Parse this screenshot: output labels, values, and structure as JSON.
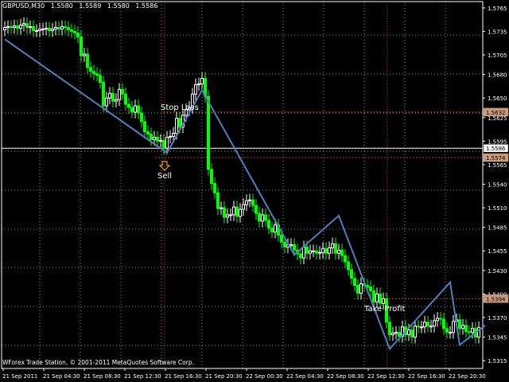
{
  "header": {
    "symbol_timeframe": "GBPUSD,M30",
    "open": "1.5580",
    "high": "1.5589",
    "low": "1.5580",
    "close": "1.5586"
  },
  "copyright": "WForex Trade Station, © 2001-2011 MetaQuotes Software Corp.",
  "annotations": {
    "stop_loss_label": "Stop Loss",
    "sell_label": "Sell",
    "take_profit_label": "Take Profit"
  },
  "colors": {
    "background": "#000000",
    "grid": "#ffffff",
    "bull_candle": "#ffffff",
    "bear_candle": "#00ff00",
    "zigzag": "#4f7fbf",
    "level_line": "#bf3a3a",
    "current_price_line": "#ffffff",
    "sell_arrow": "#e8a000"
  },
  "chart_data": {
    "type": "candlestick",
    "symbol": "GBPUSD",
    "timeframe": "M30",
    "ylim": [
      1.5305,
      1.5773
    ],
    "y_ticks": [
      "1.5765",
      "1.5735",
      "1.5705",
      "1.5680",
      "1.5650",
      "1.5625",
      "1.5595",
      "1.5565",
      "1.5540",
      "1.5510",
      "1.5485",
      "1.5455",
      "1.5430",
      "1.5400",
      "1.5370",
      "1.5345",
      "1.5315"
    ],
    "x_ticks": [
      "21 Sep 2011",
      "21 Sep 04:30",
      "21 Sep 08:30",
      "21 Sep 12:30",
      "21 Sep 16:30",
      "21 Sep 20:30",
      "22 Sep 00:30",
      "22 Sep 04:30",
      "22 Sep 08:30",
      "22 Sep 12:30",
      "22 Sep 16:30",
      "22 Sep 20:30"
    ],
    "price_tags": [
      {
        "value": "1.5632",
        "role": "stop-loss"
      },
      {
        "value": "1.5586",
        "role": "current"
      },
      {
        "value": "1.5574",
        "role": "entry"
      },
      {
        "value": "1.5394",
        "role": "take-profit"
      }
    ],
    "levels": {
      "stop_loss": 1.5632,
      "entry": 1.5574,
      "current": 1.5586,
      "take_profit": 1.5394
    },
    "zigzag": [
      [
        0,
        1.5725
      ],
      [
        51,
        1.558
      ],
      [
        62,
        1.566
      ],
      [
        91,
        1.545
      ],
      [
        105,
        1.55
      ],
      [
        121,
        1.533
      ],
      [
        140,
        1.5415
      ],
      [
        143,
        1.5335
      ],
      [
        151,
        1.536
      ]
    ],
    "closes": [
      1.574,
      1.5741,
      1.574,
      1.5742,
      1.5739,
      1.5743,
      1.5745,
      1.574,
      1.5741,
      1.5736,
      1.5736,
      1.5738,
      1.5738,
      1.5739,
      1.5736,
      1.5738,
      1.574,
      1.5738,
      1.5741,
      1.574,
      1.5737,
      1.5735,
      1.5733,
      1.5728,
      1.5704,
      1.5706,
      1.5689,
      1.5684,
      1.5681,
      1.5679,
      1.567,
      1.564,
      1.565,
      1.5656,
      1.5646,
      1.5648,
      1.5661,
      1.5655,
      1.5642,
      1.5638,
      1.5632,
      1.564,
      1.5631,
      1.562,
      1.5607,
      1.5604,
      1.5597,
      1.56,
      1.5595,
      1.5596,
      1.5586,
      1.56,
      1.5601,
      1.5605,
      1.5624,
      1.5613,
      1.5628,
      1.5635,
      1.5638,
      1.5655,
      1.5667,
      1.5668,
      1.5675,
      1.5652,
      1.5559,
      1.5541,
      1.5529,
      1.5509,
      1.551,
      1.5498,
      1.5501,
      1.5501,
      1.5511,
      1.5499,
      1.5508,
      1.5514,
      1.5519,
      1.552,
      1.5513,
      1.5503,
      1.5493,
      1.5501,
      1.5494,
      1.5484,
      1.5479,
      1.5488,
      1.5475,
      1.5466,
      1.546,
      1.5463,
      1.5463,
      1.5456,
      1.5451,
      1.5446,
      1.546,
      1.5452,
      1.5455,
      1.5455,
      1.5452,
      1.5453,
      1.5458,
      1.5452,
      1.5459,
      1.5464,
      1.5452,
      1.5456,
      1.5449,
      1.5441,
      1.5431,
      1.542,
      1.5411,
      1.5401,
      1.5413,
      1.5411,
      1.5409,
      1.5404,
      1.539,
      1.54,
      1.5388,
      1.5394,
      1.5364,
      1.5348,
      1.535,
      1.5351,
      1.5346,
      1.5358,
      1.5348,
      1.5354,
      1.5345,
      1.5359,
      1.5358,
      1.5358,
      1.5364,
      1.5359,
      1.5359,
      1.5366,
      1.5369,
      1.5368,
      1.5356,
      1.5351,
      1.5351,
      1.5365,
      1.5367,
      1.5356,
      1.536,
      1.5352,
      1.5351,
      1.5356,
      1.5345,
      1.5357
    ]
  }
}
